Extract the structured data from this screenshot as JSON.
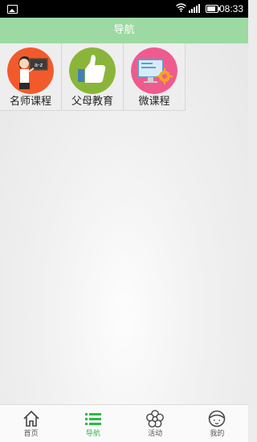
{
  "status_bar": {
    "time": "08:33",
    "icons": [
      "gallery-icon",
      "wifi-icon",
      "signal-icon",
      "battery-icon"
    ]
  },
  "header": {
    "title": "导航"
  },
  "grid": {
    "items": [
      {
        "label": "名师课程",
        "icon": "teacher-icon",
        "color": "#f25a2c"
      },
      {
        "label": "父母教育",
        "icon": "thumbs-up-icon",
        "color": "#8bb53a"
      },
      {
        "label": "微课程",
        "icon": "monitor-gear-icon",
        "color": "#ee5b8f"
      }
    ]
  },
  "bottom_nav": {
    "items": [
      {
        "label": "首页",
        "icon": "home-icon"
      },
      {
        "label": "导航",
        "icon": "list-icon",
        "active": true
      },
      {
        "label": "活动",
        "icon": "flower-icon"
      },
      {
        "label": "我的",
        "icon": "face-icon"
      }
    ],
    "active_color": "#2eb847"
  },
  "colors": {
    "header": "#9dd9a2",
    "accent": "#2eb847"
  }
}
